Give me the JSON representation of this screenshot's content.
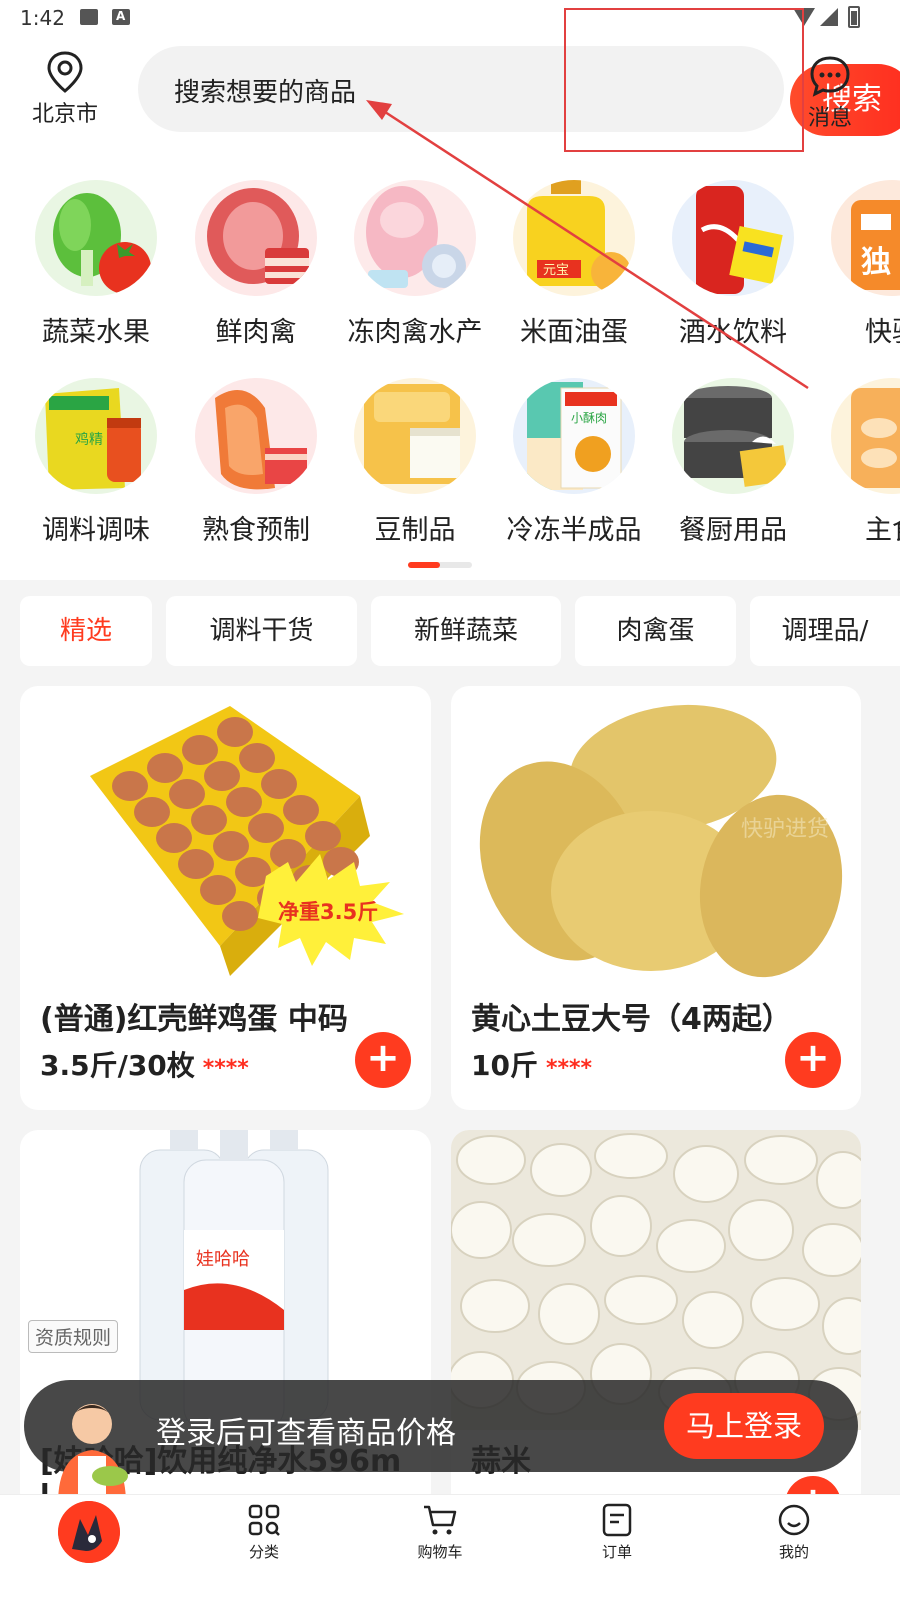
{
  "status_bar": {
    "time": "1:42"
  },
  "header": {
    "location_label": "北京市",
    "search_placeholder": "搜索想要的商品",
    "search_button": "搜索",
    "message_label": "消息"
  },
  "categories": [
    {
      "label": "蔬菜水果",
      "icon": "vegetables-icon",
      "color": "#e9f6e3"
    },
    {
      "label": "鲜肉禽",
      "icon": "fresh-meat-icon",
      "color": "#fde8e8"
    },
    {
      "label": "冻肉禽水产",
      "icon": "frozen-meat-icon",
      "color": "#fdeaea"
    },
    {
      "label": "米面油蛋",
      "icon": "rice-oil-icon",
      "color": "#fdf3dc"
    },
    {
      "label": "酒水饮料",
      "icon": "drinks-icon",
      "color": "#e8f0fb"
    },
    {
      "label": "快驴",
      "icon": "kuailv-icon",
      "color": "#fde9dc"
    },
    {
      "label": "调料调味",
      "icon": "seasoning-icon",
      "color": "#e9f6e3"
    },
    {
      "label": "熟食预制",
      "icon": "cooked-food-icon",
      "color": "#fde8e8"
    },
    {
      "label": "豆制品",
      "icon": "tofu-icon",
      "color": "#fdf3dc"
    },
    {
      "label": "冷冻半成品",
      "icon": "frozen-semi-icon",
      "color": "#e8f0fb"
    },
    {
      "label": "餐厨用品",
      "icon": "kitchen-supplies-icon",
      "color": "#e9f6e3"
    },
    {
      "label": "主食",
      "icon": "staple-food-icon",
      "color": "#fdf3dc"
    }
  ],
  "tabs": [
    "精选",
    "调料干货",
    "新鲜蔬菜",
    "肉禽蛋",
    "调理品/"
  ],
  "products": [
    {
      "title": "(普通)红壳鲜鸡蛋 中码",
      "spec": "3.5斤/30枚",
      "price": "****",
      "badge": "净重3.5斤"
    },
    {
      "title": "黄心土豆大号（4两起）",
      "spec": "10斤",
      "price": "****"
    },
    {
      "title": "[娃哈哈]饮用纯净水596m",
      "spec": "l",
      "tag": "资质规则"
    },
    {
      "title": "蒜米",
      "spec": ""
    }
  ],
  "login_banner": {
    "text": "登录后可查看商品价格",
    "button": "马上登录"
  },
  "bottom_nav": {
    "items": [
      {
        "label": "",
        "icon": "home-logo-icon"
      },
      {
        "label": "分类",
        "icon": "category-icon"
      },
      {
        "label": "购物车",
        "icon": "cart-icon"
      },
      {
        "label": "订单",
        "icon": "order-icon"
      },
      {
        "label": "我的",
        "icon": "profile-icon"
      }
    ]
  },
  "colors": {
    "accent": "#ff3b1f",
    "annotation": "#e24040"
  }
}
